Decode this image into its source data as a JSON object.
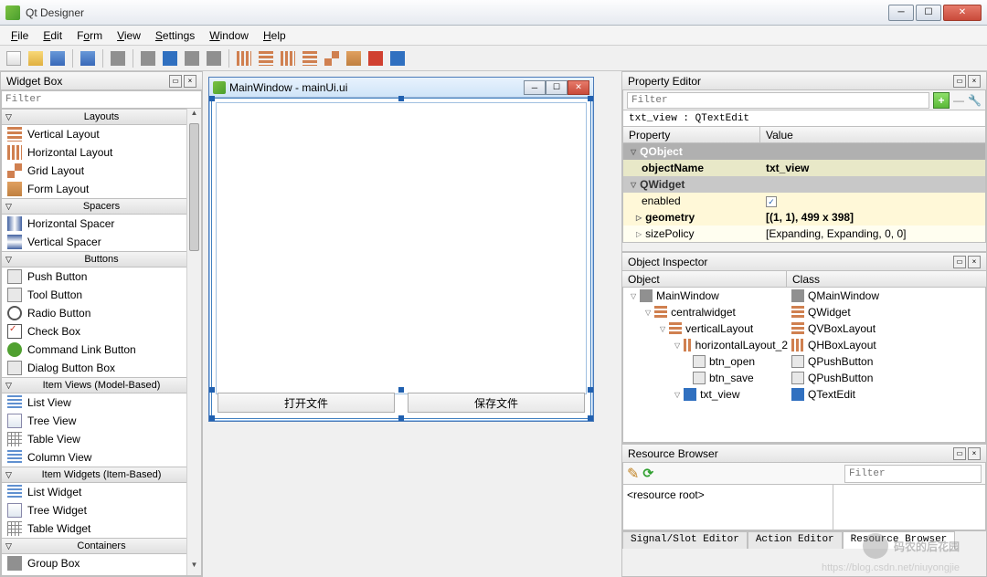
{
  "app_title": "Qt Designer",
  "menu": [
    "File",
    "Edit",
    "Form",
    "View",
    "Settings",
    "Window",
    "Help"
  ],
  "widget_box": {
    "title": "Widget Box",
    "filter_placeholder": "Filter",
    "categories": [
      {
        "name": "Layouts",
        "items": [
          "Vertical Layout",
          "Horizontal Layout",
          "Grid Layout",
          "Form Layout"
        ]
      },
      {
        "name": "Spacers",
        "items": [
          "Horizontal Spacer",
          "Vertical Spacer"
        ]
      },
      {
        "name": "Buttons",
        "items": [
          "Push Button",
          "Tool Button",
          "Radio Button",
          "Check Box",
          "Command Link Button",
          "Dialog Button Box"
        ]
      },
      {
        "name": "Item Views (Model-Based)",
        "items": [
          "List View",
          "Tree View",
          "Table View",
          "Column View"
        ]
      },
      {
        "name": "Item Widgets (Item-Based)",
        "items": [
          "List Widget",
          "Tree Widget",
          "Table Widget"
        ]
      },
      {
        "name": "Containers",
        "items": [
          "Group Box"
        ]
      }
    ]
  },
  "design": {
    "window_title": "MainWindow - mainUi.ui",
    "btn_open": "打开文件",
    "btn_save": "保存文件"
  },
  "property_editor": {
    "title": "Property Editor",
    "filter_placeholder": "Filter",
    "object_line": "txt_view : QTextEdit",
    "col_property": "Property",
    "col_value": "Value",
    "rows": {
      "qobject": "QObject",
      "objectName": "objectName",
      "objectName_v": "txt_view",
      "qwidget": "QWidget",
      "enabled": "enabled",
      "geometry": "geometry",
      "geometry_v": "[(1, 1), 499 x 398]",
      "sizePolicy": "sizePolicy",
      "sizePolicy_v": "[Expanding, Expanding, 0, 0]"
    }
  },
  "object_inspector": {
    "title": "Object Inspector",
    "col_object": "Object",
    "col_class": "Class",
    "tree": [
      {
        "indent": 0,
        "name": "MainWindow",
        "class": "QMainWindow",
        "icon": "ic-grey"
      },
      {
        "indent": 1,
        "name": "centralwidget",
        "class": "QWidget",
        "icon": "ic-vlayout"
      },
      {
        "indent": 2,
        "name": "verticalLayout",
        "class": "QVBoxLayout",
        "icon": "ic-vlayout"
      },
      {
        "indent": 3,
        "name": "horizontalLayout_2",
        "class": "QHBoxLayout",
        "icon": "ic-hlayout"
      },
      {
        "indent": 4,
        "name": "btn_open",
        "class": "QPushButton",
        "icon": "ic-btn"
      },
      {
        "indent": 4,
        "name": "btn_save",
        "class": "QPushButton",
        "icon": "ic-btn"
      },
      {
        "indent": 3,
        "name": "txt_view",
        "class": "QTextEdit",
        "icon": "ic-blue"
      }
    ]
  },
  "resource_browser": {
    "title": "Resource Browser",
    "filter_placeholder": "Filter",
    "root": "<resource root>",
    "tabs": [
      "Signal/Slot Editor",
      "Action Editor",
      "Resource Browser"
    ]
  },
  "watermark": "码农的后花园",
  "watermark_url": "https://blog.csdn.net/niuyongjie"
}
